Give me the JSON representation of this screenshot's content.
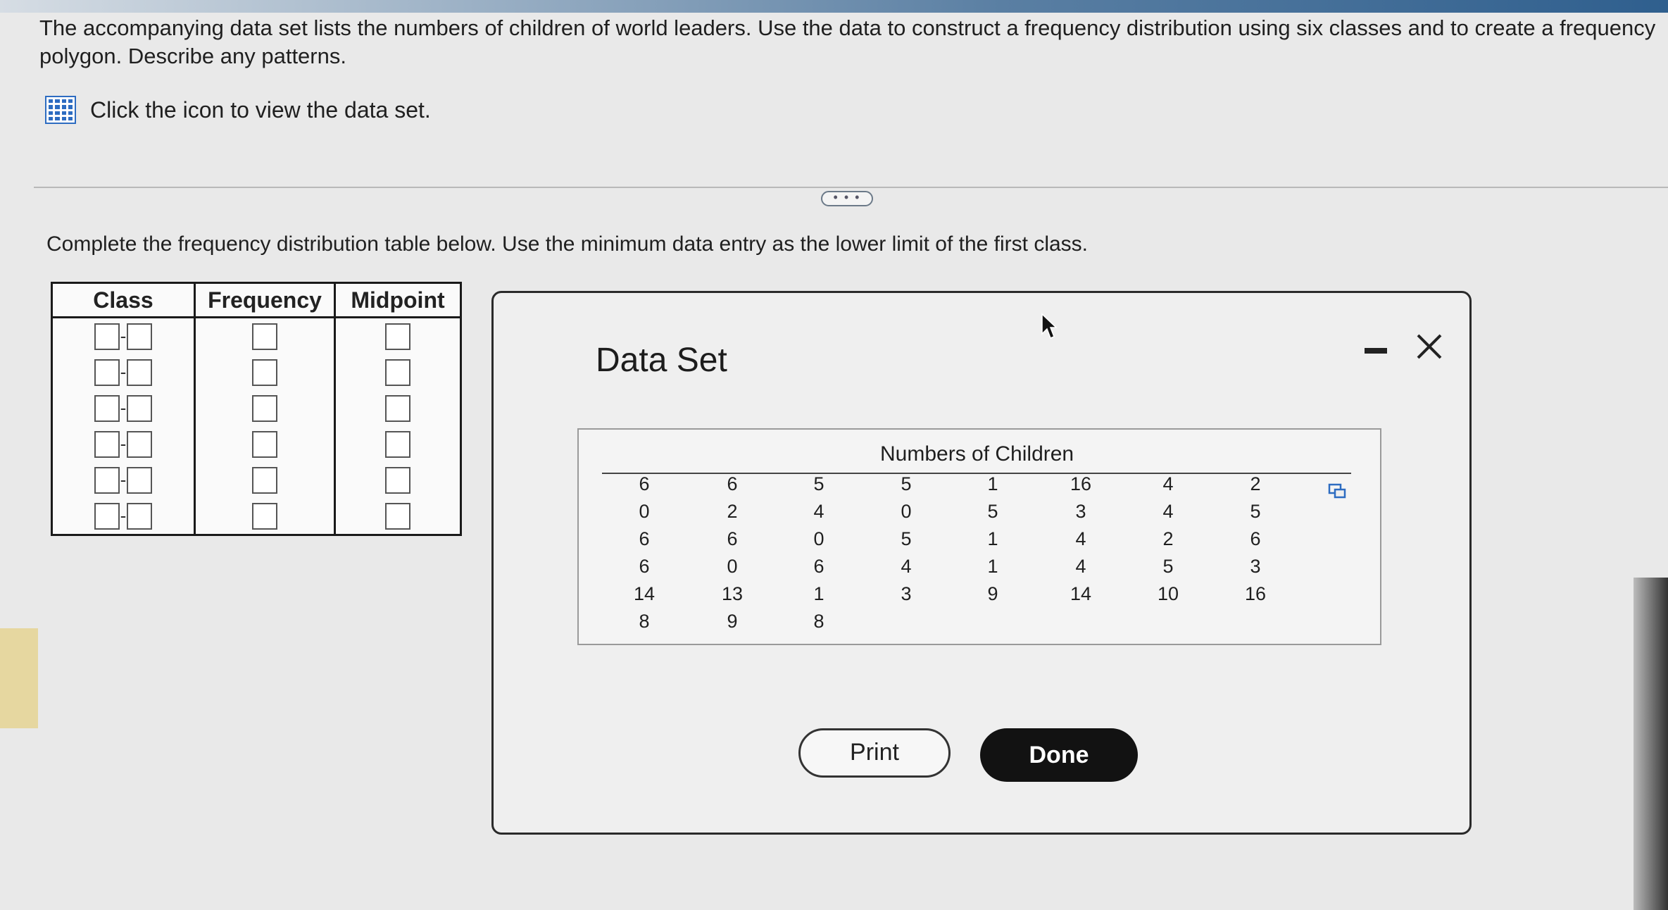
{
  "question": {
    "line1": "The accompanying data set lists the numbers of children of world leaders. Use the data to construct a frequency distribution using six classes and to create a frequency",
    "line2": "polygon. Describe any patterns."
  },
  "dataset_link": {
    "icon": "grid-table-icon",
    "label": "Click the icon to view the data set."
  },
  "expand_button": "• • •",
  "instruction": "Complete the frequency distribution table below. Use the minimum data entry as the lower limit of the first class.",
  "freq_table": {
    "headers": [
      "Class",
      "Frequency",
      "Midpoint"
    ],
    "row_count": 6,
    "class_separator": "-"
  },
  "dialog": {
    "title": "Data Set",
    "data_header": "Numbers of Children",
    "columns": [
      [
        "6",
        "0",
        "6",
        "6",
        "14",
        "8"
      ],
      [
        "6",
        "2",
        "6",
        "0",
        "13",
        "9"
      ],
      [
        "5",
        "4",
        "0",
        "6",
        "1",
        "8"
      ],
      [
        "5",
        "0",
        "5",
        "4",
        "3"
      ],
      [
        "1",
        "5",
        "1",
        "1",
        "9"
      ],
      [
        "16",
        "3",
        "4",
        "4",
        "14"
      ],
      [
        "4",
        "4",
        "2",
        "5",
        "10"
      ],
      [
        "2",
        "5",
        "6",
        "3",
        "16"
      ]
    ],
    "print_label": "Print",
    "done_label": "Done",
    "minimize_icon": "minimize-icon",
    "close_icon": "close-icon",
    "copy_icon": "copy-icon"
  },
  "colors": {
    "accent": "#2d6cc1",
    "done_bg": "#121212"
  }
}
